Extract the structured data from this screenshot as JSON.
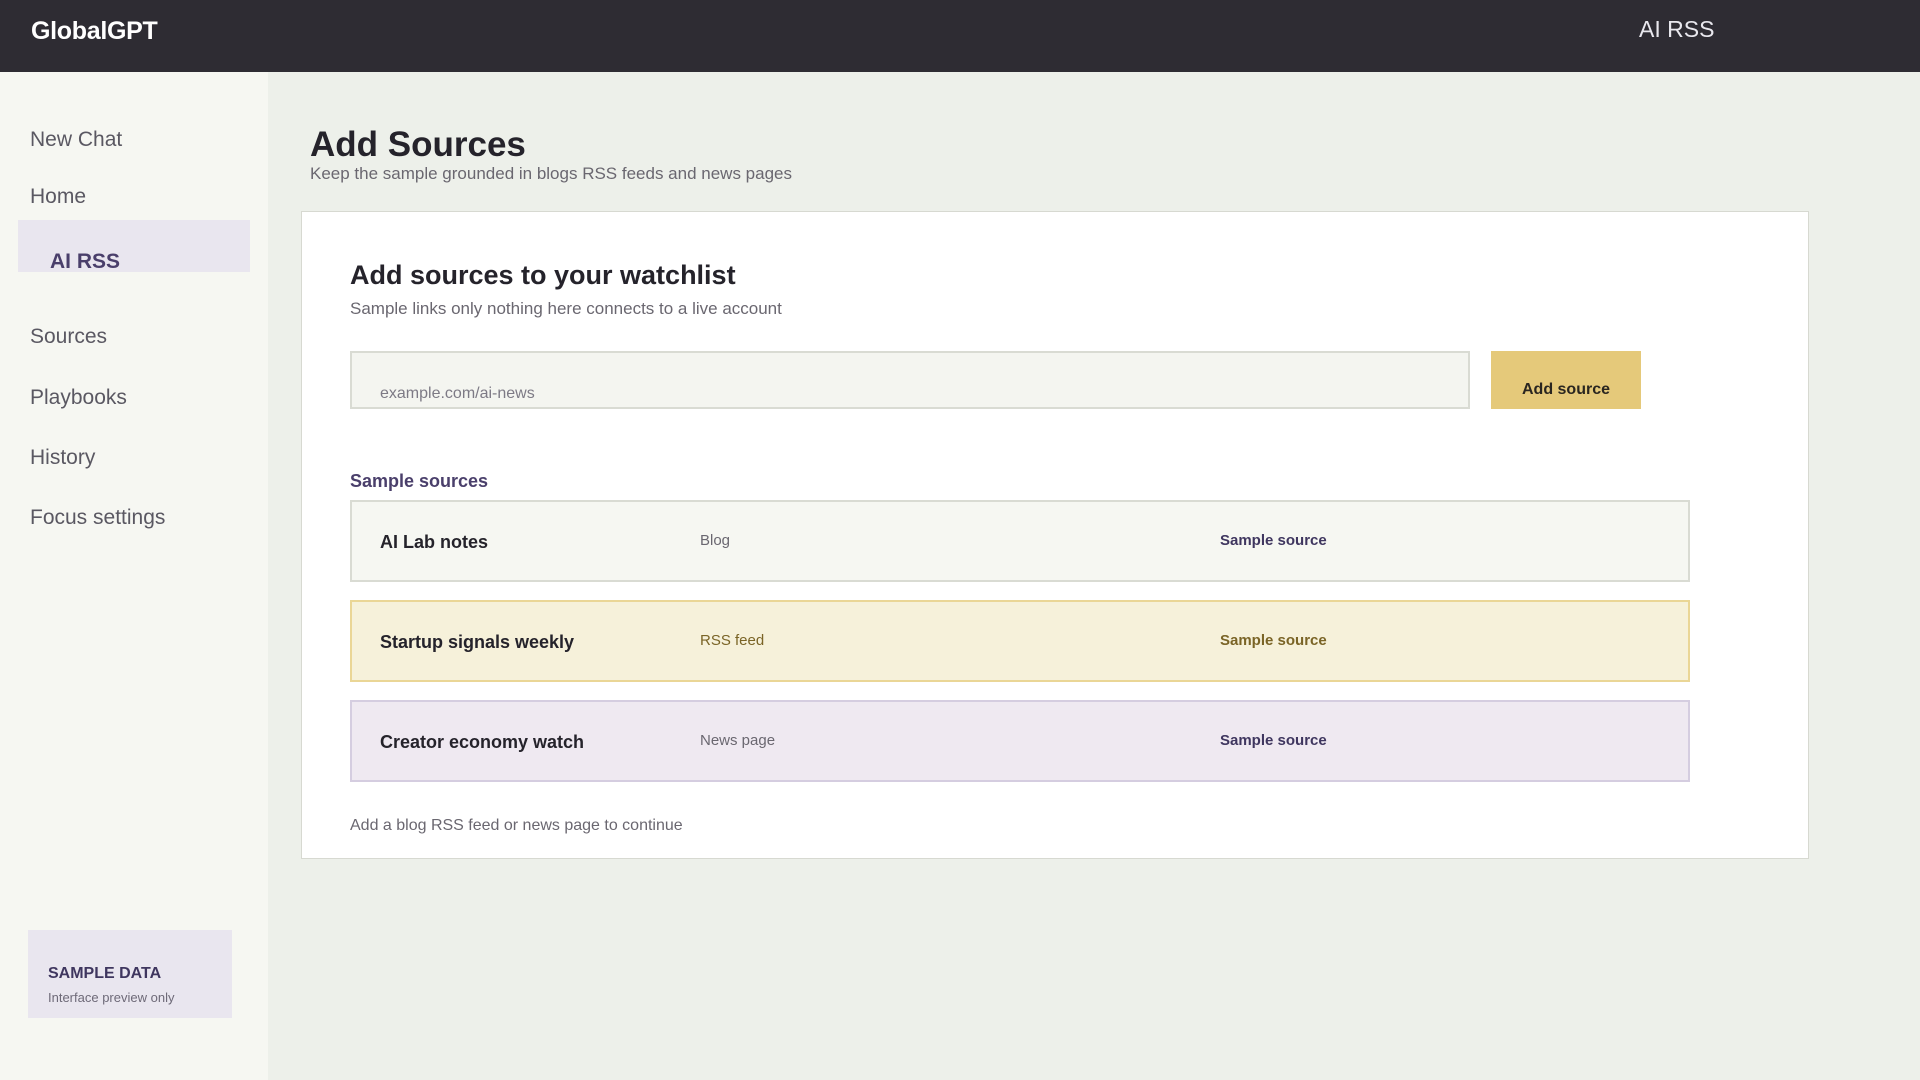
{
  "app": {
    "name": "GlobalGPT",
    "current_section": "AI RSS"
  },
  "sidebar": {
    "items": [
      {
        "label": "New Chat"
      },
      {
        "label": "Home"
      },
      {
        "label": "AI RSS",
        "active": true
      },
      {
        "label": "Sources"
      },
      {
        "label": "Playbooks"
      },
      {
        "label": "History"
      },
      {
        "label": "Focus settings"
      }
    ],
    "badge": {
      "title": "SAMPLE DATA",
      "subtitle": "Interface preview only"
    }
  },
  "page": {
    "title": "Add Sources",
    "subtitle": "Keep the sample grounded in blogs RSS feeds and news pages"
  },
  "card": {
    "title": "Add sources to your watchlist",
    "subtitle": "Sample links only  nothing here connects to a live account",
    "input": {
      "placeholder": "example.com/ai-news",
      "value": ""
    },
    "add_button": "Add source",
    "section_label": "Sample sources",
    "sources": [
      {
        "name": "AI Lab notes",
        "type": "Blog",
        "tag": "Sample source"
      },
      {
        "name": "Startup signals weekly",
        "type": "RSS feed",
        "tag": "Sample source"
      },
      {
        "name": "Creator economy watch",
        "type": "News page",
        "tag": "Sample source"
      }
    ],
    "hint": "Add a blog RSS feed or news page to continue"
  },
  "colors": {
    "topbar": "#2e2c33",
    "accent_purple": "#4a3f6b",
    "accent_gold": "#e5c97a",
    "background": "#edf0ea"
  }
}
